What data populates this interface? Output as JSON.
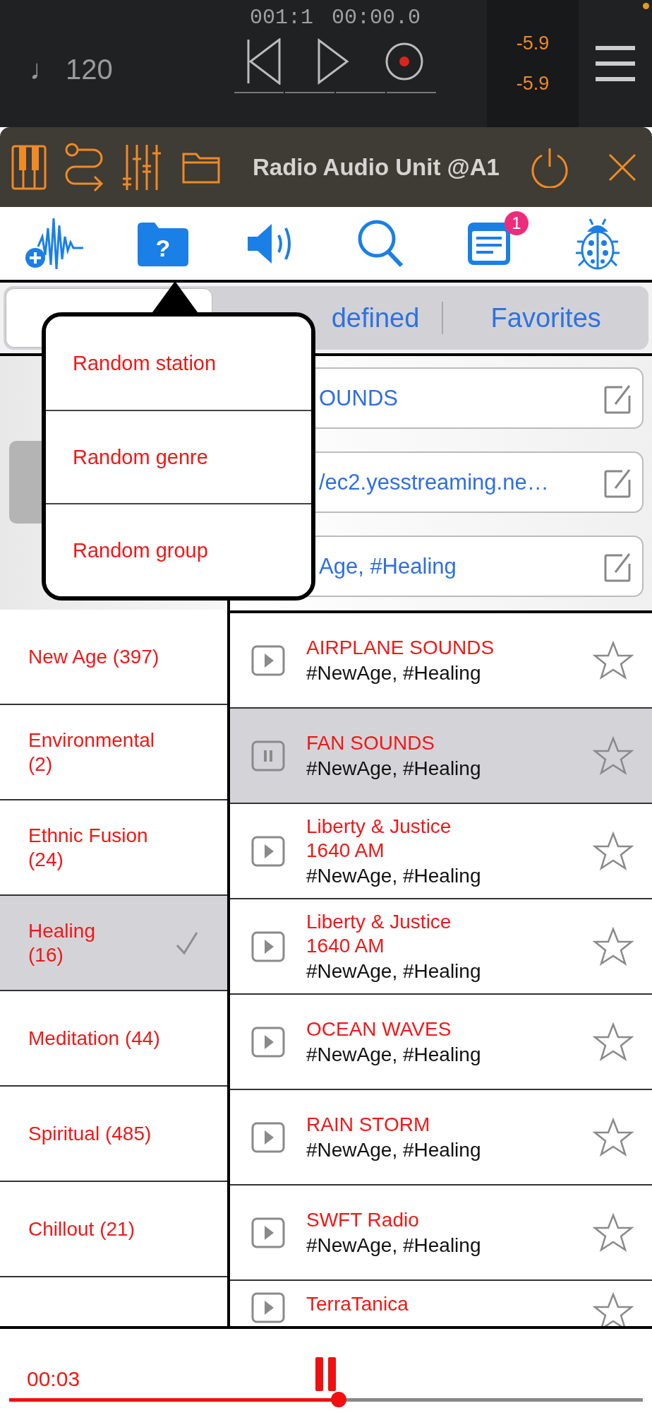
{
  "transport": {
    "tempo": "♩ 120",
    "position": "001:1",
    "time": "00:00.0",
    "meters": [
      "-5.9",
      "-5.9"
    ]
  },
  "plugin": {
    "title": "Radio Audio Unit @A1"
  },
  "toolbar": {
    "help_glyph": "?",
    "badge": "1"
  },
  "tabs": [
    {
      "selected": true
    },
    {
      "label": "defined",
      "selected": false
    },
    {
      "label": "Favorites",
      "selected": false
    }
  ],
  "station_fields": [
    {
      "value": "OUNDS"
    },
    {
      "value": "/ec2.yesstreaming.ne…"
    },
    {
      "value": "Age, #Healing"
    }
  ],
  "popover": {
    "items": [
      "Random station",
      "Random genre",
      "Random group"
    ]
  },
  "genres": [
    {
      "label": "New Age (397)",
      "selected": false
    },
    {
      "label": "Environmental\n(2)",
      "selected": false
    },
    {
      "label": "Ethnic Fusion\n(24)",
      "selected": false
    },
    {
      "label": "Healing\n(16)",
      "selected": true
    },
    {
      "label": "Meditation (44)",
      "selected": false
    },
    {
      "label": "Spiritual (485)",
      "selected": false
    },
    {
      "label": "Chillout (21)",
      "selected": false
    }
  ],
  "stations": [
    {
      "title": "AIRPLANE SOUNDS",
      "tags": "#NewAge, #Healing",
      "selected": false
    },
    {
      "title": "FAN SOUNDS",
      "tags": "#NewAge, #Healing",
      "selected": true
    },
    {
      "title": "Liberty & Justice\n1640 AM",
      "tags": "#NewAge, #Healing",
      "selected": false
    },
    {
      "title": "Liberty & Justice\n1640 AM",
      "tags": "#NewAge, #Healing",
      "selected": false
    },
    {
      "title": "OCEAN WAVES",
      "tags": "#NewAge, #Healing",
      "selected": false
    },
    {
      "title": "RAIN STORM",
      "tags": "#NewAge, #Healing",
      "selected": false
    },
    {
      "title": "SWFT Radio",
      "tags": "#NewAge, #Healing",
      "selected": false
    },
    {
      "title": "TerraTanica",
      "selected": false
    }
  ],
  "player": {
    "elapsed": "00:03",
    "level": 0.52
  }
}
